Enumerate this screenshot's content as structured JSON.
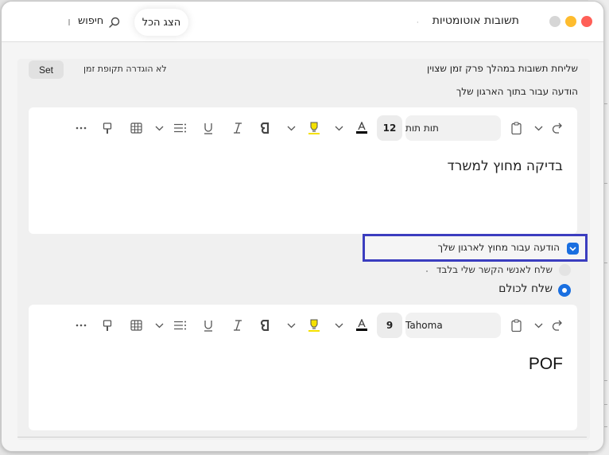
{
  "window": {
    "title": "תשובות אוטומטיות",
    "show_all": "הצג הכל",
    "search_label": "חיפוש"
  },
  "schedule": {
    "time_period_label": "שליחת תשובות במהלך פרק זמן שצוין",
    "no_period_label": "לא הוגדרה תקופת זמן",
    "set_button": "Set"
  },
  "inside_org": {
    "label": "הודעה עבור בתוך הארגון שלך",
    "editor": {
      "font": "תות תות",
      "size": "12",
      "body": "בדיקה מחוץ למשרד"
    }
  },
  "outside_org": {
    "checkbox_label": "הודעה עבור מחוץ לארגון שלך",
    "checked": true,
    "option_contacts": "שלח לאנשי הקשר שלי בלבד",
    "option_all": "שלח לכולם",
    "selected_option": "all",
    "editor": {
      "font": "Tahoma",
      "size": "9",
      "body": "POF"
    }
  },
  "icons": {
    "toolbar": [
      "more-icon",
      "format-painter-icon",
      "table-icon",
      "chevron-down-icon",
      "bullet-list-icon",
      "underline-icon",
      "italic-icon",
      "bold-icon",
      "highlighter-icon",
      "font-color-icon",
      "paste-icon",
      "undo-icon"
    ]
  },
  "colors": {
    "accent": "#1a6fe0",
    "focus_frame": "#3b3dbf",
    "highlight": "#f5e100",
    "close": "#ff5f57",
    "minimize": "#febc2e"
  }
}
